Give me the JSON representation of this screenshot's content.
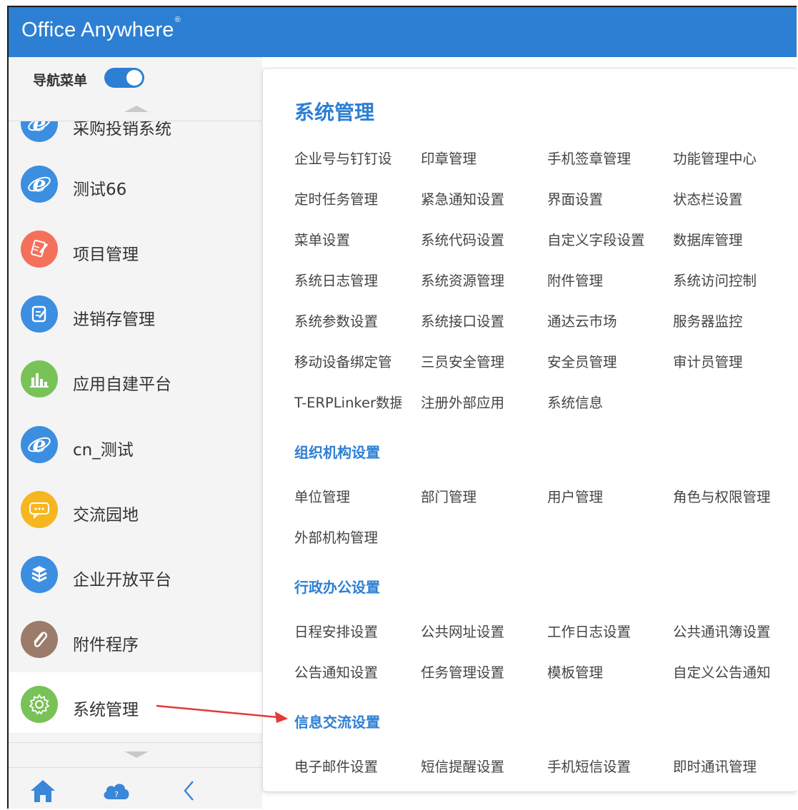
{
  "header": {
    "brand": "Office Anywhere",
    "brand_mark": "®"
  },
  "sidebar": {
    "nav_toggle_label": "导航菜单",
    "nav_toggle_on": true,
    "items": [
      {
        "label": "采购投销系统",
        "icon": "ie-icon",
        "color": "#3c8ee0"
      },
      {
        "label": "测试66",
        "icon": "ie-icon",
        "color": "#3c8ee0"
      },
      {
        "label": "项目管理",
        "icon": "document-pen-icon",
        "color": "#f5705a"
      },
      {
        "label": "进销存管理",
        "icon": "edit-note-icon",
        "color": "#3c8ee0"
      },
      {
        "label": "应用自建平台",
        "icon": "bar-chart-icon",
        "color": "#78c257"
      },
      {
        "label": "cn_测试",
        "icon": "ie-icon",
        "color": "#3c8ee0"
      },
      {
        "label": "交流园地",
        "icon": "chat-bubble-icon",
        "color": "#f6b61f"
      },
      {
        "label": "企业开放平台",
        "icon": "open-platform-icon",
        "color": "#3c8ee0"
      },
      {
        "label": "附件程序",
        "icon": "paperclip-icon",
        "color": "#9b7b6a"
      },
      {
        "label": "系统管理",
        "icon": "gear-icon",
        "color": "#78c257"
      }
    ],
    "active_index": 9,
    "bottom_icons": [
      "home-icon",
      "cloud-help-icon",
      "collapse-left-icon"
    ]
  },
  "panel": {
    "sections": [
      {
        "title": "系统管理",
        "links": [
          "企业号与钉钉设",
          "印章管理",
          "手机签章管理",
          "功能管理中心",
          "定时任务管理",
          "紧急通知设置",
          "界面设置",
          "状态栏设置",
          "菜单设置",
          "系统代码设置",
          "自定义字段设置",
          "数据库管理",
          "系统日志管理",
          "系统资源管理",
          "附件管理",
          "系统访问控制",
          "系统参数设置",
          "系统接口设置",
          "通达云市场",
          "服务器监控",
          "移动设备绑定管",
          "三员安全管理",
          "安全员管理",
          "审计员管理",
          "T-ERPLinker数据",
          "注册外部应用",
          "系统信息"
        ]
      },
      {
        "title": "组织机构设置",
        "links": [
          "单位管理",
          "部门管理",
          "用户管理",
          "角色与权限管理",
          "外部机构管理"
        ]
      },
      {
        "title": "行政办公设置",
        "links": [
          "日程安排设置",
          "公共网址设置",
          "工作日志设置",
          "公共通讯簿设置",
          "公告通知设置",
          "任务管理设置",
          "模板管理",
          "自定义公告通知"
        ]
      },
      {
        "title": "信息交流设置",
        "links": [
          "电子邮件设置",
          "短信提醒设置",
          "手机短信设置",
          "即时通讯管理"
        ]
      }
    ]
  },
  "annotation": {
    "arrow_color": "#e53935"
  },
  "colors": {
    "primary": "#2d7fd3",
    "sidebar_bg": "#f4f4f4"
  }
}
